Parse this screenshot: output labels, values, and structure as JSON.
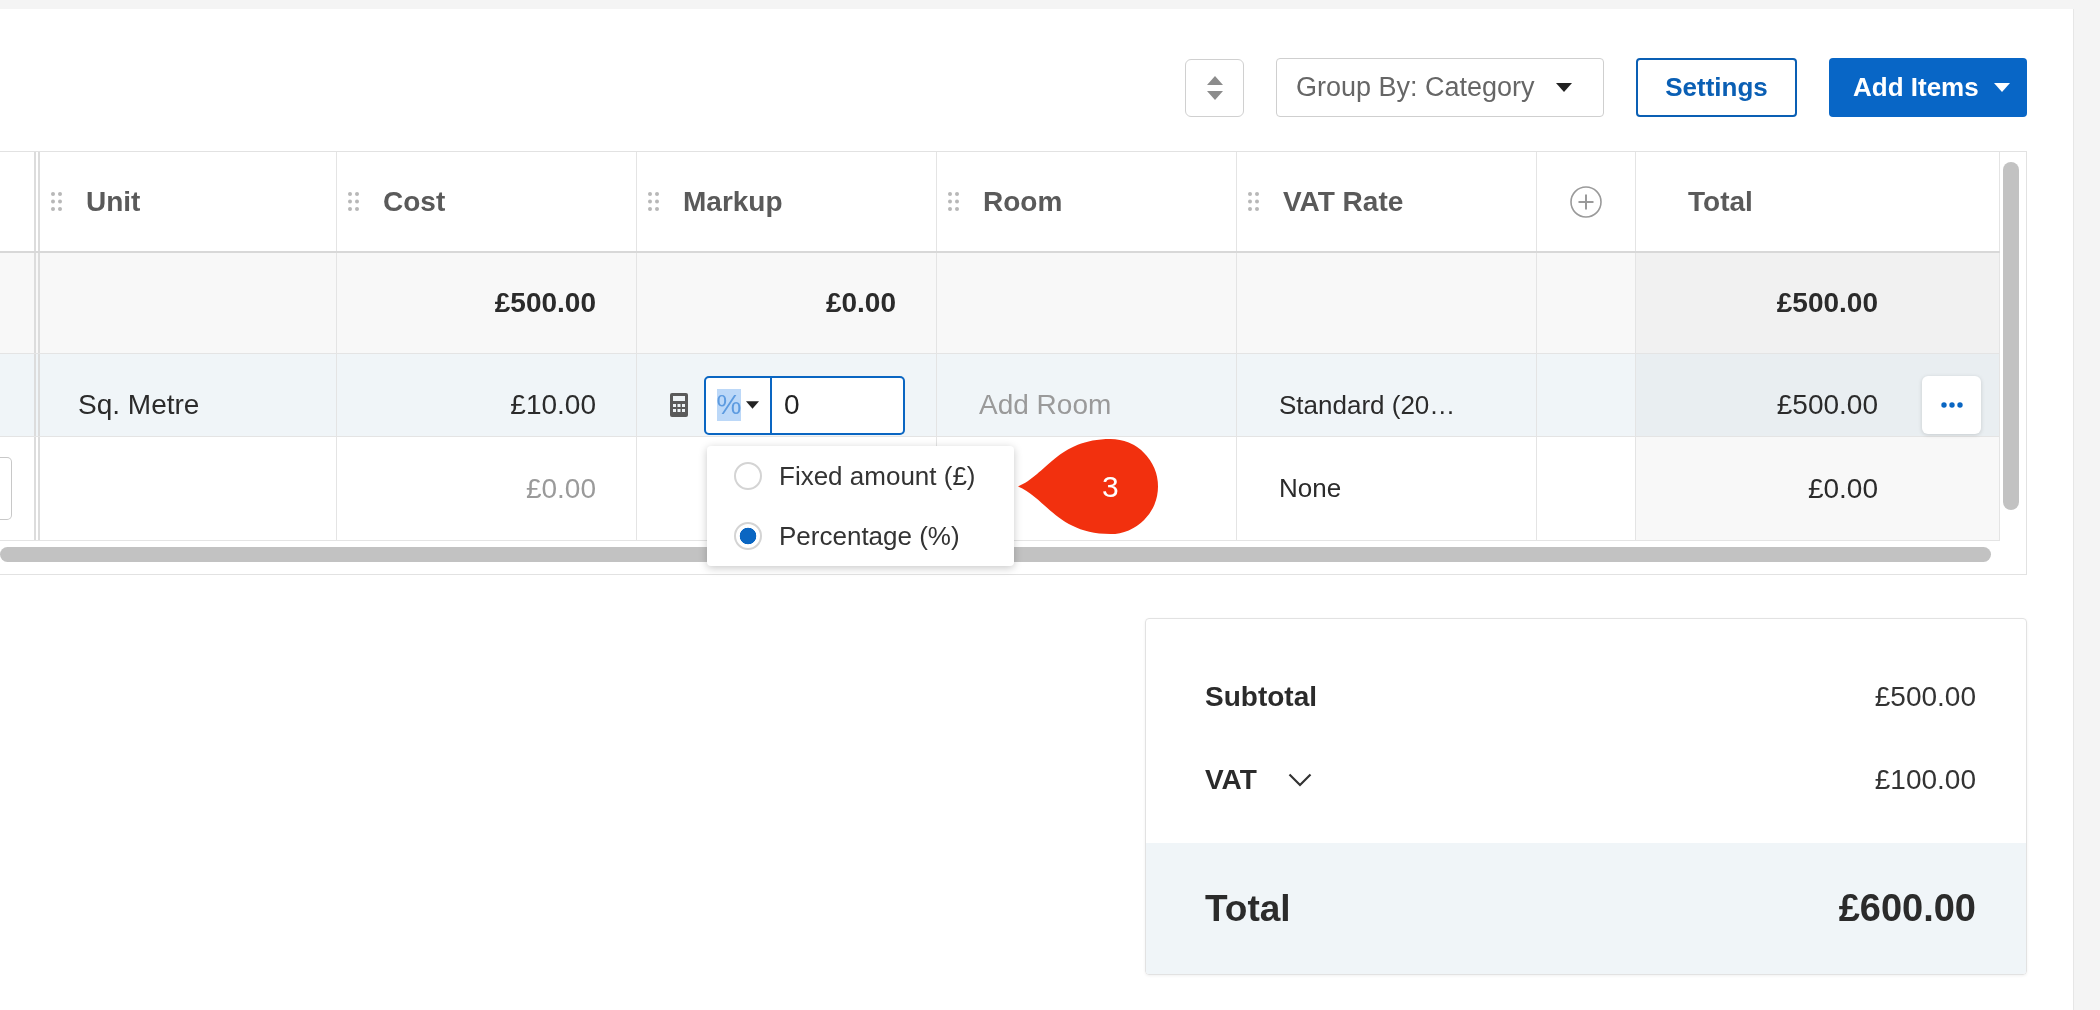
{
  "toolbar": {
    "group_by": {
      "label": "Group By: Category"
    },
    "settings_button": {
      "label": "Settings"
    },
    "add_items_button": {
      "label": "Add Items",
      "dropdown": true
    }
  },
  "table": {
    "columns": [
      {
        "label": "Unit",
        "kind": "draggable"
      },
      {
        "label": "Cost",
        "kind": "draggable"
      },
      {
        "label": "Markup",
        "kind": "draggable"
      },
      {
        "label": "Room",
        "kind": "draggable"
      },
      {
        "label": "VAT Rate",
        "kind": "draggable"
      },
      {
        "kind": "add_column"
      },
      {
        "label": "Total",
        "kind": "fixed"
      }
    ],
    "rows": [
      {
        "kind": "group",
        "cost": "£500.00",
        "markup": "£0.00",
        "total": "£500.00"
      },
      {
        "kind": "item",
        "selected": true,
        "leading_field": false,
        "unit": "Sq. Metre",
        "cost": {
          "value": "£10.00"
        },
        "markup": {
          "symbol": "%",
          "symbol_highlighted": true,
          "value": "0",
          "menu_open": true,
          "options": [
            {
              "label": "Fixed amount (£)",
              "selected": false
            },
            {
              "label": "Percentage (%)",
              "selected": true
            }
          ],
          "annotation": {
            "label": "3"
          }
        },
        "room": {
          "placeholder": "Add Room"
        },
        "vat_rate": "Standard (20…",
        "total": "£500.00",
        "actions_button": true
      },
      {
        "kind": "item",
        "selected": false,
        "leading_field": true,
        "cost": {
          "placeholder": "£0.00"
        },
        "vat_rate": "None",
        "total": "£0.00",
        "actions_button": false
      }
    ]
  },
  "summary": {
    "rows": [
      {
        "label": "Subtotal",
        "value": "£500.00",
        "expandable": false
      },
      {
        "label": "VAT",
        "value": "£100.00",
        "expandable": true
      }
    ],
    "total": {
      "label": "Total",
      "value": "£600.00"
    }
  }
}
